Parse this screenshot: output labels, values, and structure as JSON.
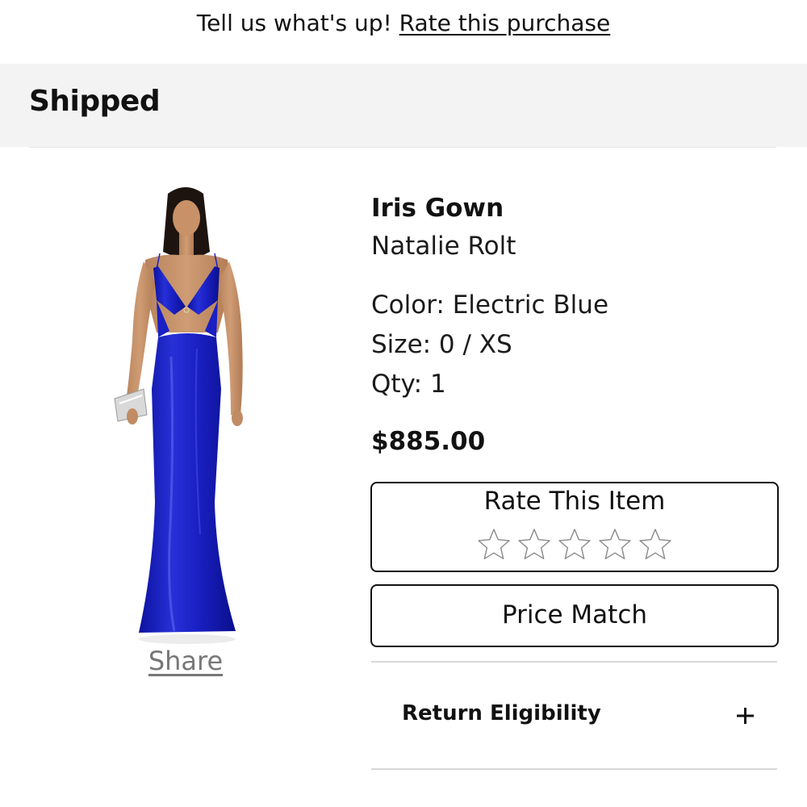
{
  "banner": {
    "prompt": "Tell us what's up!",
    "link": "Rate this purchase"
  },
  "order": {
    "status": "Shipped"
  },
  "product": {
    "name": "Iris Gown",
    "brand": "Natalie Rolt",
    "color": "Color: Electric Blue",
    "size": "Size: 0 / XS",
    "qty": "Qty: 1",
    "price": "$885.00",
    "share_label": "Share",
    "image_alt": "Model wearing electric blue satin cut-out maxi gown"
  },
  "rating": {
    "label": "Rate This Item",
    "max_stars": 5,
    "current": 0
  },
  "actions": {
    "price_match": "Price Match"
  },
  "return_policy": {
    "label": "Return Eligibility",
    "expand_icon": "plus-icon"
  },
  "colors": {
    "band": "#f3f3f3",
    "text": "#111111",
    "muted": "#777777",
    "dress": "#1a1fc2"
  }
}
